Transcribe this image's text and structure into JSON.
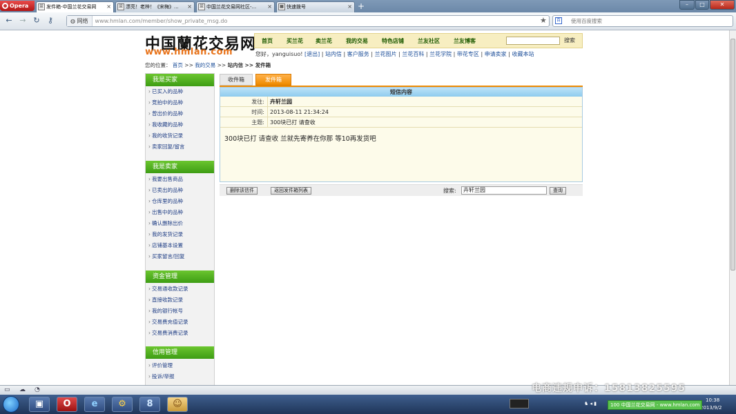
{
  "browser": {
    "opera_label": "Opera",
    "tabs": [
      {
        "label": "发件箱-中国兰花交易网",
        "icon": "兰"
      },
      {
        "label": "漂亮！老梓！《宋梅》...",
        "icon": "兰"
      },
      {
        "label": "中国兰花交易网社区-...",
        "icon": "兰"
      },
      {
        "label": "快速拨号",
        "icon": "▦"
      }
    ],
    "new_tab": "+",
    "site_badge": "网络",
    "url": "www.hmlan.com/member/show_private_msg.do",
    "search_placeholder": "使用百度搜索"
  },
  "site": {
    "logo_cn": "中国蘭花交易网",
    "logo_en": "www.hmlan.com",
    "nav": [
      "首页",
      "买兰花",
      "卖兰花",
      "我的交易",
      "特色店铺",
      "兰友社区",
      "兰友博客"
    ],
    "search_button": "搜索",
    "user_greeting": "您好，yanguisuo!",
    "user_links": [
      "[退出]",
      "站内信",
      "客户服务",
      "兰花图片",
      "兰花百科",
      "兰花学院",
      "带花专区",
      "申请卖家",
      "收藏本站"
    ],
    "breadcrumb": {
      "prefix": "您的位置：",
      "home": "首页",
      "sep1": ">>",
      "my_trade": "我的交易",
      "sep2": ">>",
      "inbox": "站内信",
      "current": ">> 发件箱"
    }
  },
  "sidebar": {
    "sections": [
      {
        "title": "我是买家",
        "items": [
          "已买入的品种",
          "竞拍中的品种",
          "曾出价的品种",
          "我收藏的品种",
          "我的收货记录",
          "卖家回复/留言"
        ]
      },
      {
        "title": "我是卖家",
        "items": [
          "我要出售商品",
          "已卖出的品种",
          "仓库里的品种",
          "出售中的品种",
          "确认删除出价",
          "我的发货记录",
          "店铺基本设置",
          "买家留言/回复"
        ]
      },
      {
        "title": "资金管理",
        "items": [
          "交易通收款记录",
          "直接收款记录",
          "我的银行帐号",
          "交易费充值记录",
          "交易费消费记录"
        ]
      },
      {
        "title": "信用管理",
        "items": [
          "评价管理",
          "投诉/举报"
        ]
      }
    ]
  },
  "mailbox": {
    "tab_inbox": "收件箱",
    "tab_outbox": "发件箱",
    "header": "短信内容",
    "to_label": "发往:",
    "to_value": "卉轩兰园",
    "time_label": "时间:",
    "time_value": "2013-08-11 21:34:24",
    "subject_label": "主题:",
    "subject_value": "300块已打 请查收",
    "body": "300块已打 请查收 兰就先寄养在你那 等10再发货吧",
    "btn_delete": "删除该信件",
    "btn_back": "返回发件箱列表",
    "search_label": "搜索:",
    "search_value": "卉轩兰园",
    "btn_query": "查询"
  },
  "taskbar": {
    "watermark": "电商违规申诉：15813825595",
    "active_window": "中国兰花交易网 - www.hmlan.com",
    "battery": "100",
    "clock_time": "10:38",
    "clock_date": "2013/9/2"
  }
}
